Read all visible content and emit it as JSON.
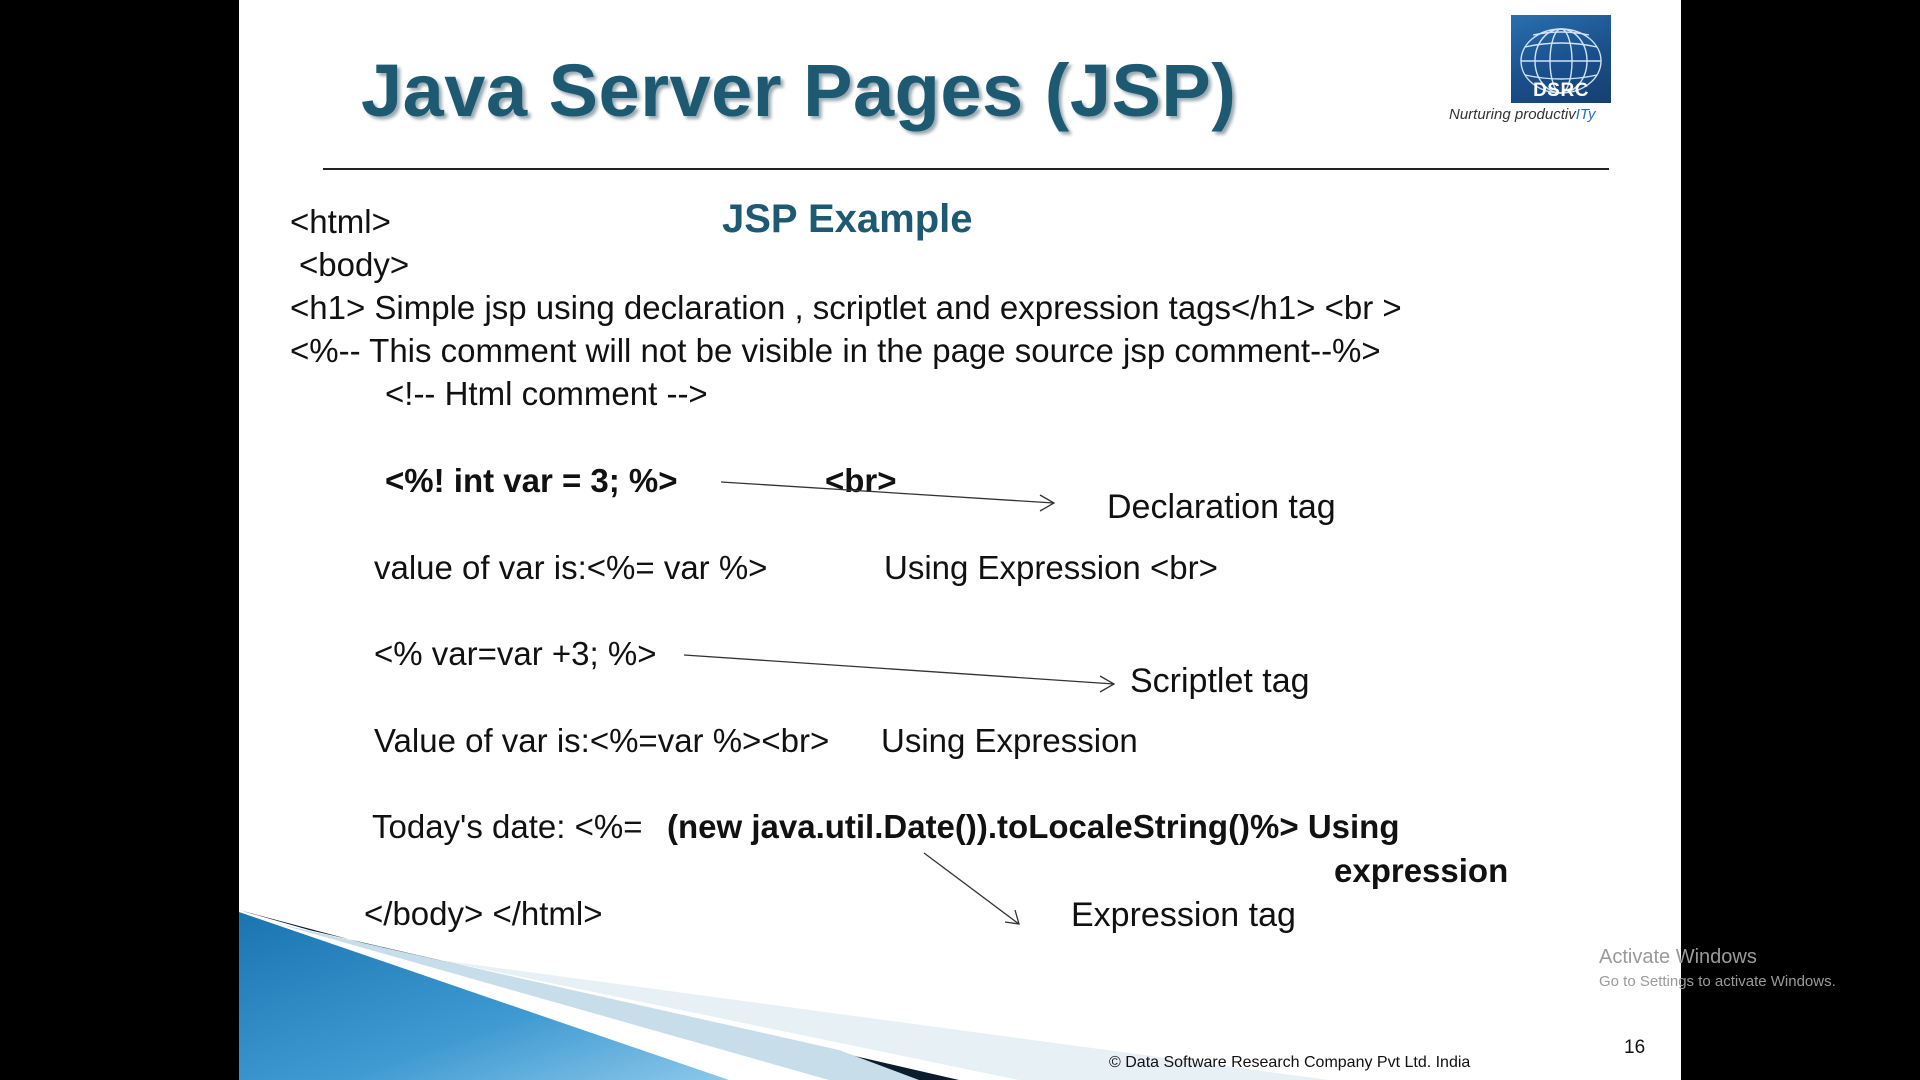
{
  "slide": {
    "title": "Java Server Pages (JSP)",
    "subtitle": "JSP Example",
    "logo": {
      "text": "DSRC",
      "tagline_prefix": "Nurturing productiv",
      "tagline_highlight": "ITy"
    },
    "code_lines": [
      "<html>",
      "<body>",
      "<h1> Simple jsp using declaration , scriptlet and expression tags</h1> <br >",
      "<%-- This comment will not be visible in the page source  jsp comment--%>",
      "<!-- Html comment -->",
      "<%! int var = 3; %>",
      "<br>",
      "value of var is:<%= var %>",
      "Using Expression  <br>",
      "<% var=var +3;  %>",
      "Value of var is:<%=var %><br>",
      "Using Expression",
      "Today's date: <%= ",
      "(new java.util.Date()).toLocaleString()%>  Using",
      "expression",
      "</body> </html>"
    ],
    "annotations": {
      "declaration": "Declaration tag",
      "scriptlet": "Scriptlet tag",
      "expression": "Expression tag"
    },
    "footer": {
      "copyright": "© Data Software Research Company Pvt Ltd. India",
      "page_number": "16"
    }
  },
  "overlay": {
    "activate_title": "Activate Windows",
    "activate_subtitle": "Go to Settings to activate Windows."
  },
  "colors": {
    "title": "#1d5a72",
    "logo": "#1a4f8a",
    "background": "#000000"
  }
}
